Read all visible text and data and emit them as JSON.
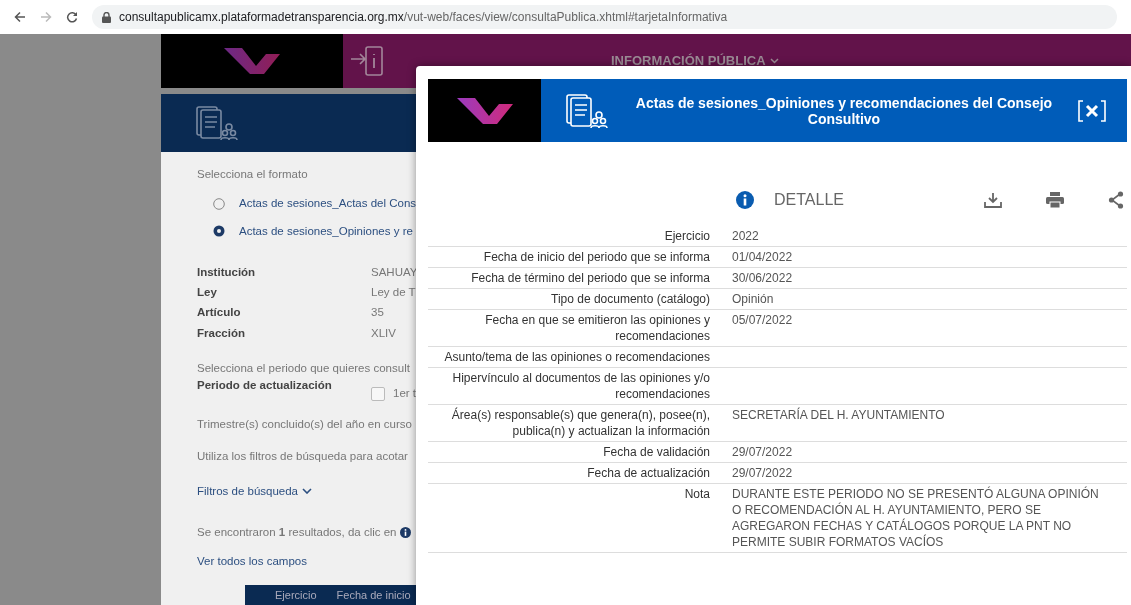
{
  "browser": {
    "url_host": "consultapublicamx.plataformadetransparencia.org.mx",
    "url_path": "/vut-web/faces/view/consultaPublica.xhtml#tarjetaInformativa"
  },
  "header": {
    "menu_label": "INFORMACIÓN PÚBLICA"
  },
  "background_page": {
    "format_prompt": "Selecciona el formato",
    "formats": [
      {
        "label": "Actas de sesiones_Actas del Cons",
        "selected": false
      },
      {
        "label": "Actas de sesiones_Opiniones y re",
        "selected": true
      }
    ],
    "details": [
      {
        "label": "Institución",
        "value": "SAHUAY"
      },
      {
        "label": "Ley",
        "value": "Ley de T"
      },
      {
        "label": "Artículo",
        "value": "35"
      },
      {
        "label": "Fracción",
        "value": "XLIV"
      }
    ],
    "period_prompt": "Selecciona el periodo que quieres consult",
    "period_label": "Periodo de actualización",
    "period_options": [
      {
        "label": "1er t",
        "checked": false
      }
    ],
    "quarters_note": "Trimestre(s) concluido(s) del año en curso",
    "filters_hint": "Utiliza los filtros de búsqueda para acotar",
    "filters_toggle": "Filtros de búsqueda",
    "results_text": "Se encontraron **1** resultados, da clic en",
    "view_all_link": "Ver todos los campos",
    "table_columns": [
      "Ejercicio",
      "Fecha de inicio"
    ]
  },
  "modal": {
    "title": "Actas de sesiones_Opiniones y recomendaciones del Consejo Consultivo",
    "section": "DETALLE",
    "fields": [
      {
        "label": "Ejercicio",
        "value": "2022"
      },
      {
        "label": "Fecha de inicio del periodo que se informa",
        "value": "01/04/2022"
      },
      {
        "label": "Fecha de término del periodo que se informa",
        "value": "30/06/2022"
      },
      {
        "label": "Tipo de documento (catálogo)",
        "value": "Opinión"
      },
      {
        "label": "Fecha en que se emitieron las opiniones y recomendaciones",
        "value": "05/07/2022"
      },
      {
        "label": "Asunto/tema de las opiniones o recomendaciones"
      },
      {
        "label": "Hipervínculo al documentos de las opiniones y/o recomendaciones"
      },
      {
        "label": "Área(s) responsable(s) que genera(n), posee(n), publica(n) y actualizan la información",
        "value": "SECRETARÍA DEL H. AYUNTAMIENTO"
      },
      {
        "label": "Fecha de validación",
        "value": "29/07/2022"
      },
      {
        "label": "Fecha de actualización",
        "value": "29/07/2022"
      },
      {
        "label": "Nota",
        "value": "DURANTE ESTE PERIODO NO SE PRESENTÓ ALGUNA OPINIÓN O RECOMENDACIÓN AL H. AYUNTAMIENTO, PERO SE AGREGARON FECHAS Y CATÁLOGOS PORQUE LA PNT NO PERMITE SUBIR FORMATOS VACÍOS"
      }
    ]
  }
}
